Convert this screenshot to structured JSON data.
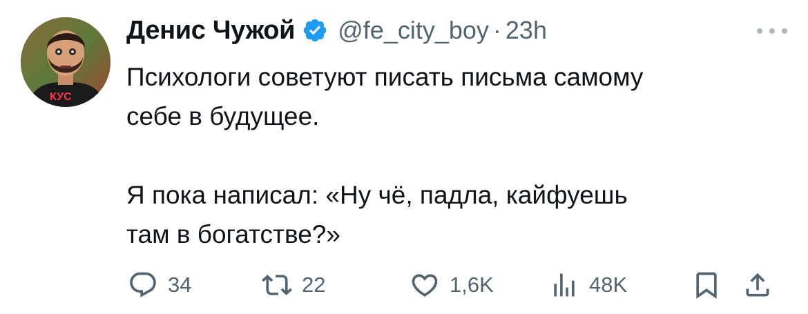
{
  "author": {
    "name": "Денис Чужой",
    "handle": "@fe_city_boy",
    "separator": "·",
    "time": "23h",
    "avatar_shirt_text": "КУС"
  },
  "tweet": {
    "text": "Психологи советуют писать письма самому\nсебе в будущее.\n\nЯ пока написал: «Ну чё, падла, кайфуешь\nтам в богатстве?»"
  },
  "actions": {
    "replies": "34",
    "retweets": "22",
    "likes": "1,6K",
    "views": "48K"
  },
  "colors": {
    "verified": "#1d9bf0",
    "secondary_text": "#536471",
    "text": "#0f1419"
  },
  "icons": [
    "verified-badge-icon",
    "more-icon",
    "reply-icon",
    "retweet-icon",
    "like-icon",
    "views-icon",
    "bookmark-icon",
    "share-icon"
  ]
}
